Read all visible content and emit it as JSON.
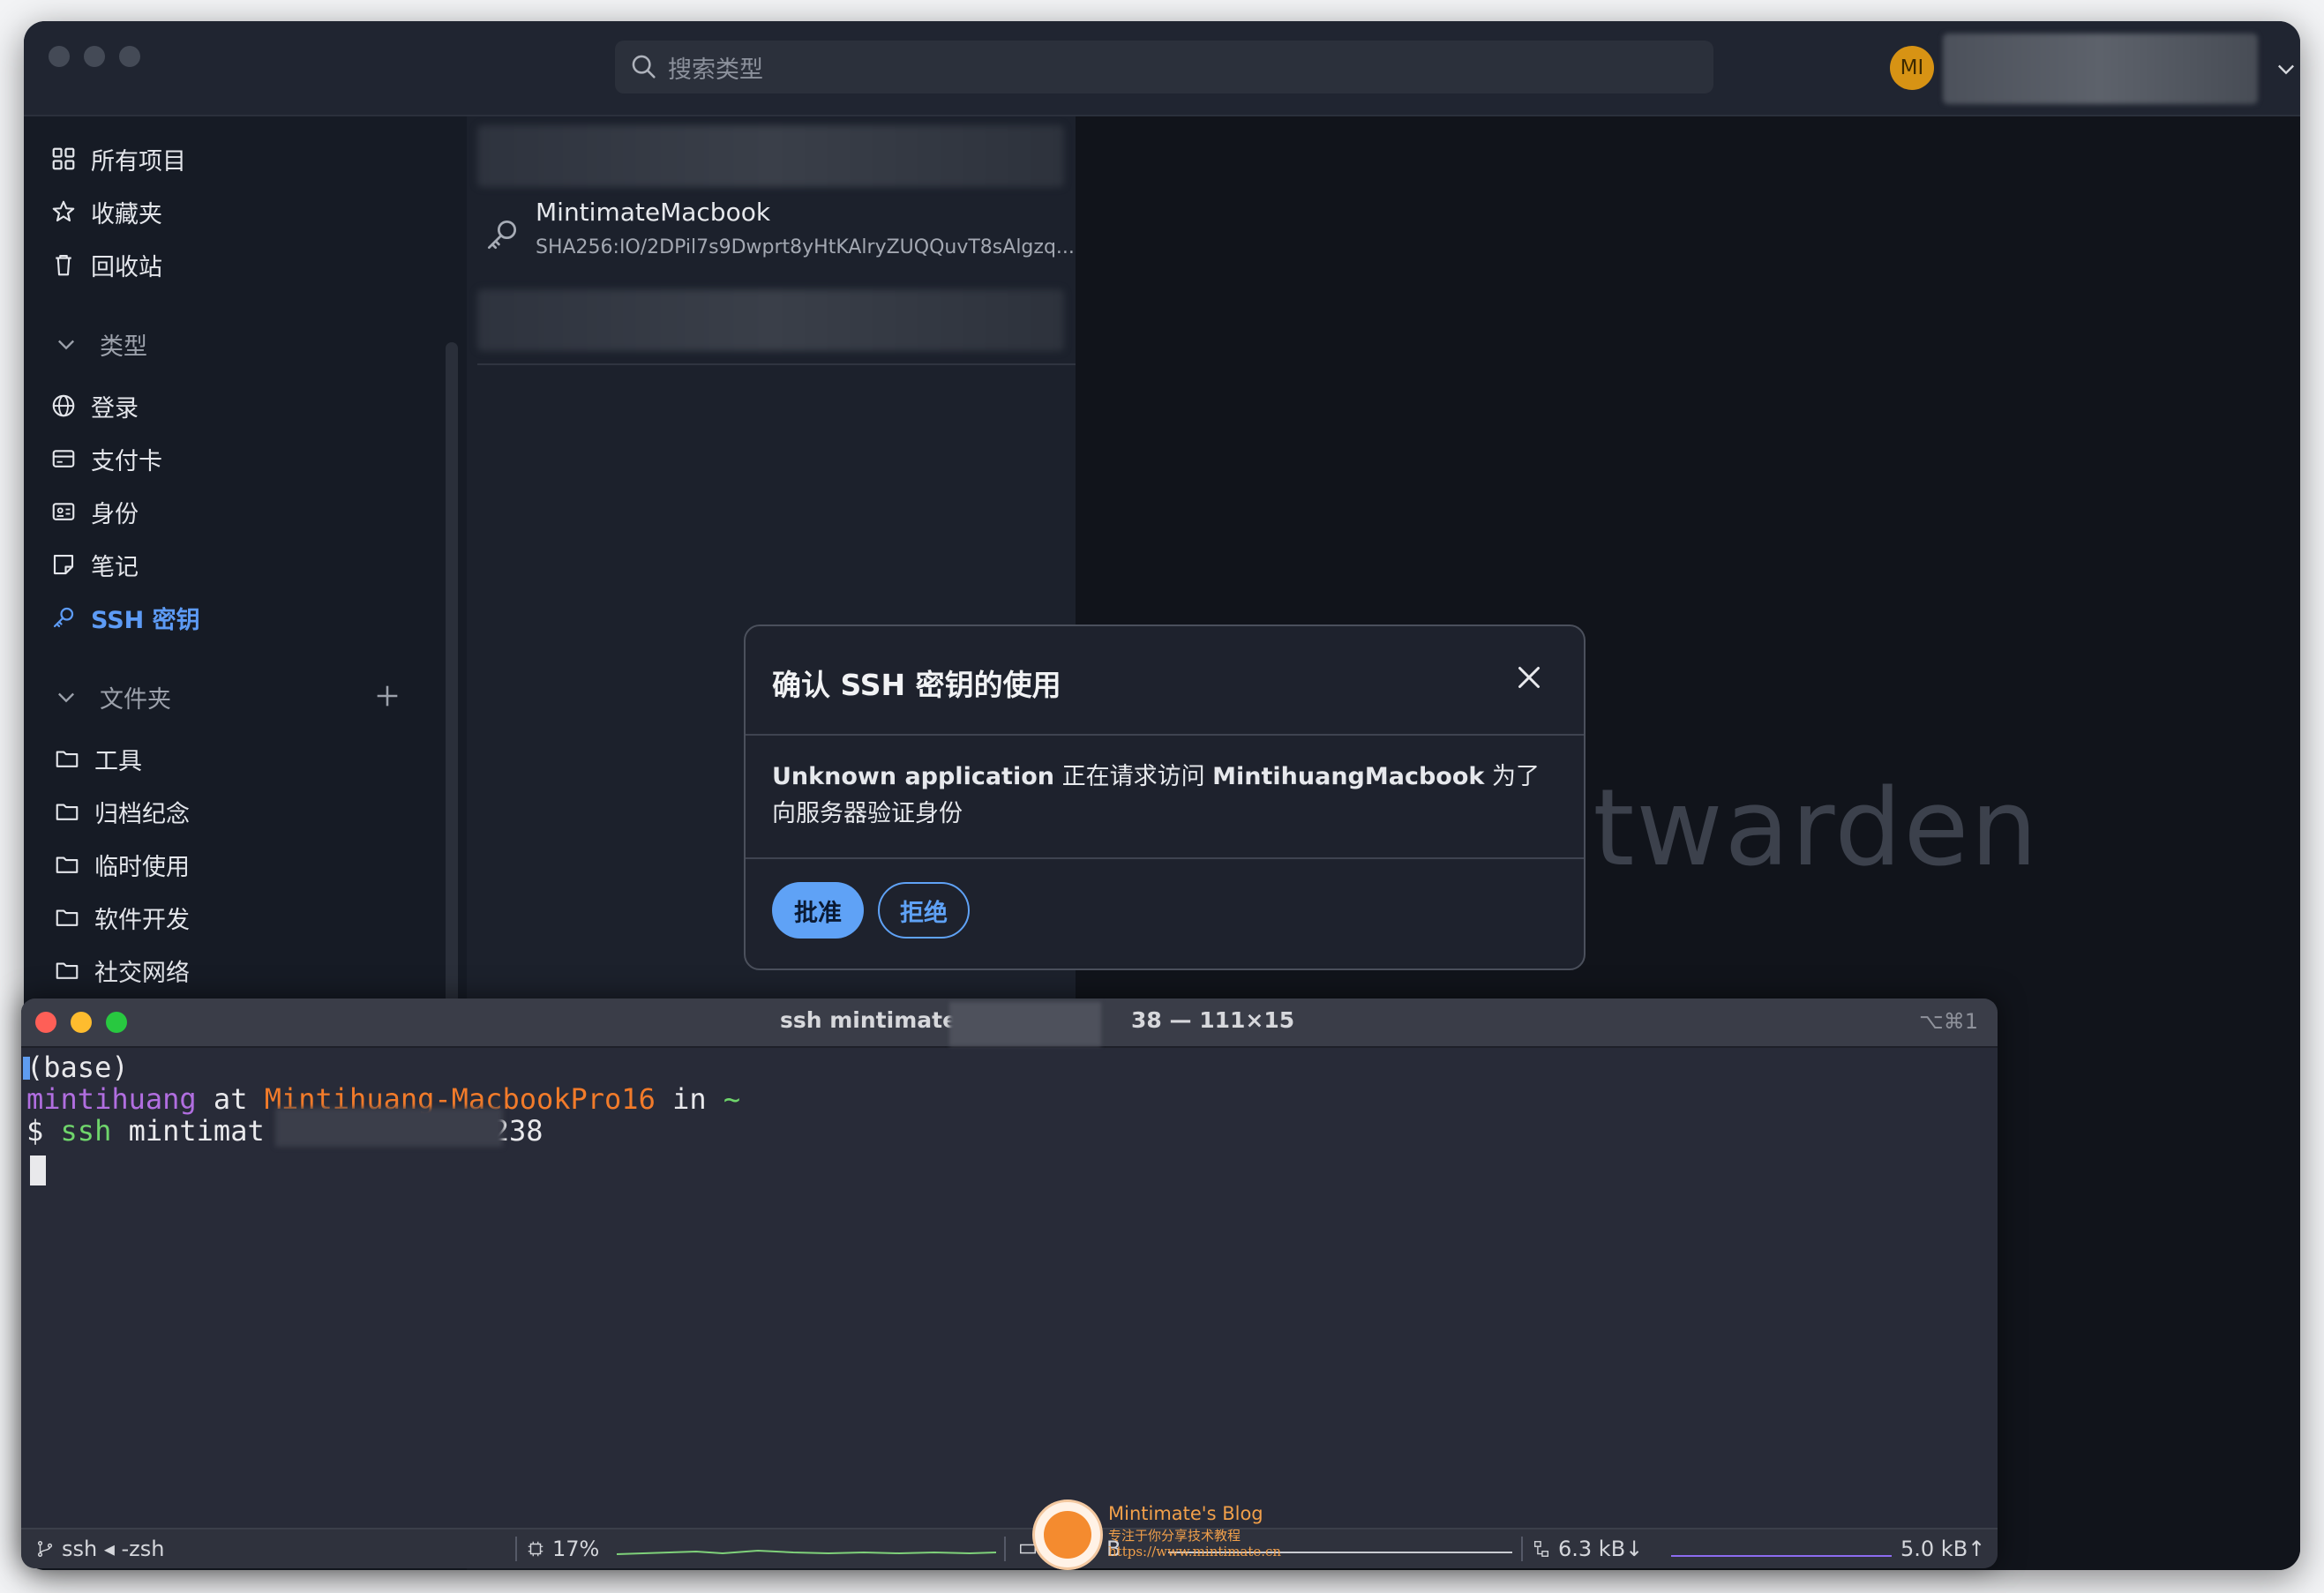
{
  "bitwarden": {
    "search_placeholder": "搜索类型",
    "avatar_initials": "MI",
    "nav": {
      "all_items": "所有项目",
      "favorites": "收藏夹",
      "trash": "回收站"
    },
    "types_header": "类型",
    "types": [
      "登录",
      "支付卡",
      "身份",
      "笔记",
      "SSH 密钥"
    ],
    "folders_header": "文件夹",
    "folders": [
      "工具",
      "归档纪念",
      "临时使用",
      "软件开发",
      "社交网络"
    ],
    "list_item": {
      "name": "MintimateMacbook",
      "fingerprint": "SHA256:IO/2DPil7s9Dwprt8yHtKAlryZUQQuvT8sAlgzq..."
    },
    "watermark_text": "itwarden"
  },
  "dialog": {
    "title": "确认 SSH 密钥的使用",
    "app_name": "Unknown application",
    "message_mid": " 正在请求访问 ",
    "key_name": "MintihuangMacbook",
    "message_end": " 为了 向服务器验证身份",
    "approve_label": "批准",
    "deny_label": "拒绝"
  },
  "terminal": {
    "title_left": "ssh mintimate@",
    "title_right": "38 — 111×15",
    "shortcut": "⌥⌘1",
    "lines": {
      "env": "(base)",
      "user": "mintihuang",
      "at": " at ",
      "host": "Mintihuang-MacbookPro16",
      "in": " in ",
      "path": "~",
      "prompt": "$ ",
      "cmd": "ssh",
      "cmd_args": " mintimat",
      "cmd_tail": "238"
    },
    "statusbar": {
      "session": "ssh ◂ -zsh",
      "cpu": "17%",
      "mem_partial": "B",
      "net_down": "6.3 kB↓",
      "net_up": "5.0 kB↑"
    }
  },
  "watermark_blog": {
    "title": "Mintimate's Blog",
    "subtitle": "专注于你分享技术教程",
    "url": "https://www.mintimate.cn"
  }
}
